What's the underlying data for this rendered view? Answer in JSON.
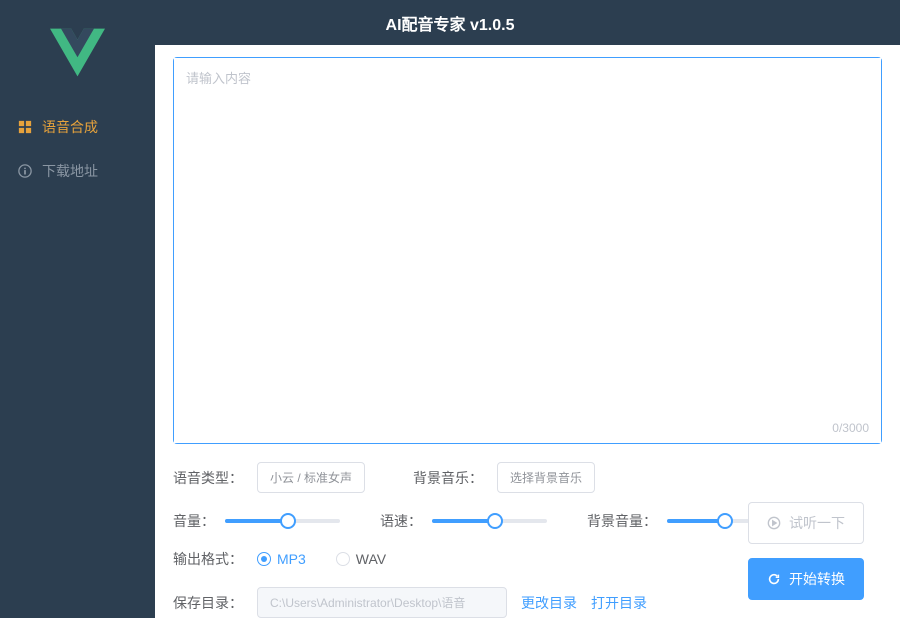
{
  "header": {
    "title": "AI配音专家 v1.0.5"
  },
  "sidebar": {
    "items": [
      {
        "label": "语音合成",
        "icon": "grid-icon",
        "active": true
      },
      {
        "label": "下载地址",
        "icon": "info-icon",
        "active": false
      }
    ]
  },
  "textarea": {
    "placeholder": "请输入内容",
    "value": "",
    "count": "0/3000"
  },
  "voice_type": {
    "label": "语音类型：",
    "value": "小云 / 标准女声"
  },
  "bg_music": {
    "label": "背景音乐：",
    "value": "选择背景音乐"
  },
  "volume": {
    "label": "音量：",
    "percent": 55
  },
  "speed": {
    "label": "语速：",
    "percent": 55
  },
  "bg_volume": {
    "label": "背景音量：",
    "percent": 50
  },
  "output_format": {
    "label": "输出格式：",
    "options": [
      {
        "value": "MP3",
        "checked": true
      },
      {
        "value": "WAV",
        "checked": false
      }
    ]
  },
  "save_dir": {
    "label": "保存目录：",
    "path": "C:\\Users\\Administrator\\Desktop\\语音",
    "change": "更改目录",
    "open": "打开目录"
  },
  "actions": {
    "preview": "试听一下",
    "convert": "开始转换"
  }
}
